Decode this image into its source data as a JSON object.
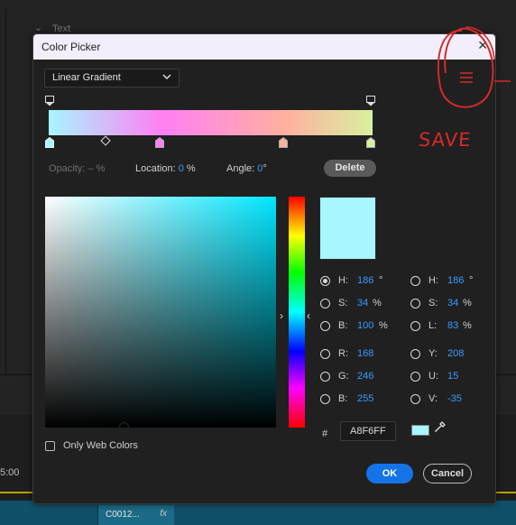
{
  "background": {
    "section_header": "Text",
    "timecode": "5:00",
    "clip_name": "C0012...",
    "clip_fx": "fx"
  },
  "dialog": {
    "title": "Color Picker",
    "close_glyph": "✕",
    "gradient_type": "Linear Gradient",
    "opacity_label": "Opacity:",
    "opacity_value": "– %",
    "location_label": "Location:",
    "location_value": "0",
    "location_unit": "%",
    "angle_label": "Angle:",
    "angle_value": "0",
    "angle_unit": "°",
    "delete_label": "Delete",
    "hsb": [
      {
        "label": "H:",
        "value": "186",
        "unit": "°",
        "selected": true
      },
      {
        "label": "S:",
        "value": "34",
        "unit": "%",
        "selected": false
      },
      {
        "label": "B:",
        "value": "100",
        "unit": "%",
        "selected": false
      }
    ],
    "rgb": [
      {
        "label": "R:",
        "value": "168"
      },
      {
        "label": "G:",
        "value": "246"
      },
      {
        "label": "B:",
        "value": "255"
      }
    ],
    "hsl": [
      {
        "label": "H:",
        "value": "186",
        "unit": "°"
      },
      {
        "label": "S:",
        "value": "34",
        "unit": "%"
      },
      {
        "label": "L:",
        "value": "83",
        "unit": "%"
      }
    ],
    "yuv": [
      {
        "label": "Y:",
        "value": "208"
      },
      {
        "label": "U:",
        "value": "15"
      },
      {
        "label": "V:",
        "value": "-35"
      }
    ],
    "hex_label": "#",
    "hex_value": "A8F6FF",
    "only_web_colors": "Only Web Colors",
    "ok_label": "OK",
    "cancel_label": "Cancel",
    "current_color": "#a8f6ff",
    "gradient_stops": [
      "#a8f6ff",
      "#ff80f4",
      "#ffb0a0",
      "#d8f0a0"
    ]
  },
  "annotation": {
    "text": "SAVE",
    "color": "#d42a2a"
  },
  "colors": {
    "accent": "#1473e6",
    "value_blue": "#3b9bff"
  }
}
